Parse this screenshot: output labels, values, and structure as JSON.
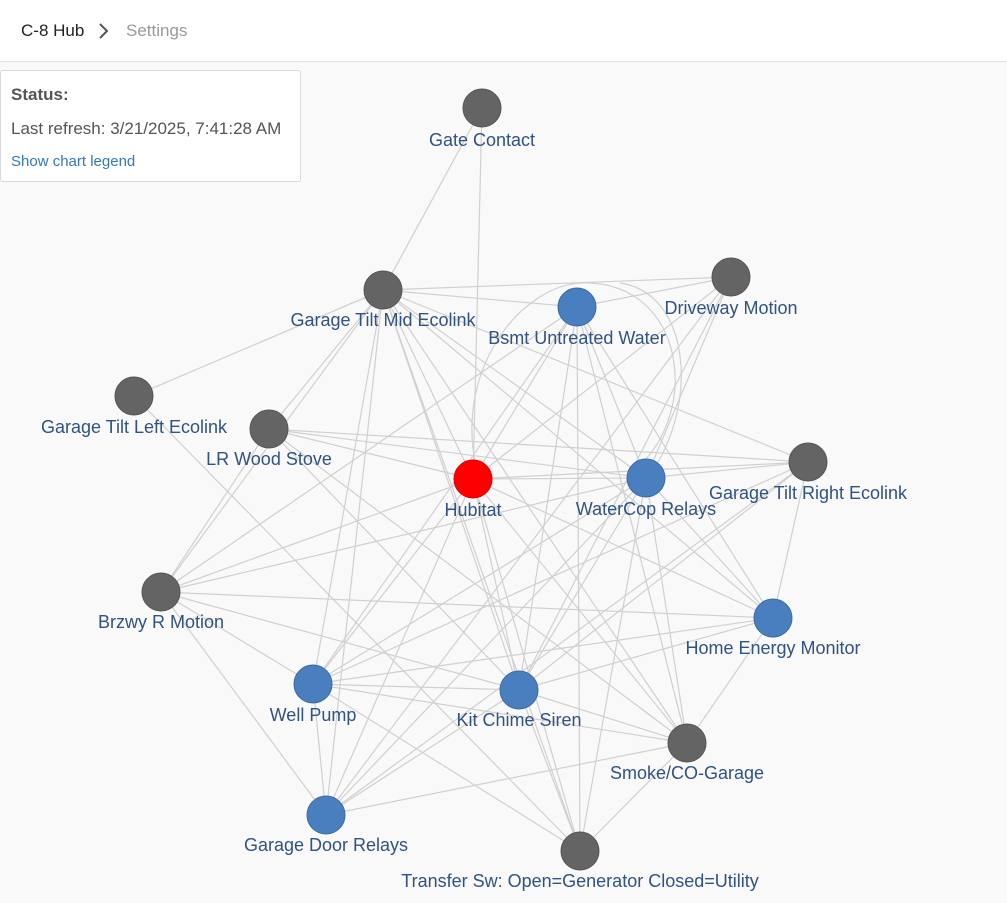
{
  "breadcrumb": {
    "hub": "C-8 Hub",
    "current": "Settings"
  },
  "status": {
    "title": "Status:",
    "last_refresh": "Last refresh: 3/21/2025, 7:41:28 AM",
    "legend_link": "Show chart legend"
  },
  "colors": {
    "hub": "#ff0000",
    "repeater": "#4a7fbf",
    "device": "#646464",
    "edge": "#d0d0d0",
    "label": "#2f5384"
  },
  "nodes": [
    {
      "id": "gate",
      "label": "Gate Contact",
      "kind": "device"
    },
    {
      "id": "gtmid",
      "label": "Garage Tilt Mid Ecolink",
      "kind": "device"
    },
    {
      "id": "bsmt",
      "label": "Bsmt Untreated Water",
      "kind": "repeater"
    },
    {
      "id": "drive",
      "label": "Driveway Motion",
      "kind": "device"
    },
    {
      "id": "gtleft",
      "label": "Garage Tilt Left Ecolink",
      "kind": "device"
    },
    {
      "id": "lrwood",
      "label": "LR Wood Stove",
      "kind": "device"
    },
    {
      "id": "hubitat",
      "label": "Hubitat",
      "kind": "hub"
    },
    {
      "id": "watercop",
      "label": "WaterCop Relays",
      "kind": "repeater"
    },
    {
      "id": "gtright",
      "label": "Garage Tilt Right Ecolink",
      "kind": "device"
    },
    {
      "id": "brzwy",
      "label": "Brzwy R Motion",
      "kind": "device"
    },
    {
      "id": "hem",
      "label": "Home Energy Monitor",
      "kind": "repeater"
    },
    {
      "id": "well",
      "label": "Well Pump",
      "kind": "repeater"
    },
    {
      "id": "chime",
      "label": "Kit Chime Siren",
      "kind": "repeater"
    },
    {
      "id": "smoke",
      "label": "Smoke/CO-Garage",
      "kind": "device"
    },
    {
      "id": "gdr",
      "label": "Garage Door Relays",
      "kind": "repeater"
    },
    {
      "id": "xfer",
      "label": "Transfer Sw: Open=Generator  Closed=Utility",
      "kind": "device"
    }
  ],
  "edges": [
    [
      "gate",
      "gtmid"
    ],
    [
      "gate",
      "hubitat"
    ],
    [
      "gtmid",
      "drive"
    ],
    [
      "gtmid",
      "bsmt"
    ],
    [
      "gtmid",
      "gtleft"
    ],
    [
      "gtmid",
      "lrwood"
    ],
    [
      "gtmid",
      "hubitat"
    ],
    [
      "gtmid",
      "watercop"
    ],
    [
      "gtmid",
      "gtright"
    ],
    [
      "gtmid",
      "brzwy"
    ],
    [
      "gtmid",
      "well"
    ],
    [
      "gtmid",
      "chime"
    ],
    [
      "gtmid",
      "gdr"
    ],
    [
      "gtmid",
      "smoke"
    ],
    [
      "gtmid",
      "xfer"
    ],
    [
      "gtmid",
      "hem"
    ],
    [
      "bsmt",
      "hubitat"
    ],
    [
      "bsmt",
      "drive"
    ],
    [
      "bsmt",
      "watercop"
    ],
    [
      "bsmt",
      "chime"
    ],
    [
      "bsmt",
      "well"
    ],
    [
      "bsmt",
      "smoke"
    ],
    [
      "bsmt",
      "xfer"
    ],
    [
      "bsmt",
      "brzwy"
    ],
    [
      "bsmt",
      "hem"
    ],
    [
      "drive",
      "hubitat"
    ],
    [
      "drive",
      "watercop"
    ],
    [
      "drive",
      "chime"
    ],
    [
      "drive",
      "gdr"
    ],
    [
      "lrwood",
      "hubitat"
    ],
    [
      "lrwood",
      "watercop"
    ],
    [
      "lrwood",
      "gtright"
    ],
    [
      "lrwood",
      "chime"
    ],
    [
      "lrwood",
      "brzwy"
    ],
    [
      "lrwood",
      "smoke"
    ],
    [
      "gtleft",
      "xfer"
    ],
    [
      "hubitat",
      "watercop"
    ],
    [
      "hubitat",
      "gtright"
    ],
    [
      "hubitat",
      "brzwy"
    ],
    [
      "hubitat",
      "chime"
    ],
    [
      "hubitat",
      "well"
    ],
    [
      "hubitat",
      "gdr"
    ],
    [
      "hubitat",
      "hem"
    ],
    [
      "hubitat",
      "xfer"
    ],
    [
      "hubitat",
      "smoke"
    ],
    [
      "watercop",
      "gtright"
    ],
    [
      "watercop",
      "brzwy"
    ],
    [
      "watercop",
      "hem"
    ],
    [
      "watercop",
      "chime"
    ],
    [
      "watercop",
      "well"
    ],
    [
      "watercop",
      "gdr"
    ],
    [
      "watercop",
      "smoke"
    ],
    [
      "watercop",
      "xfer"
    ],
    [
      "gtright",
      "well"
    ],
    [
      "gtright",
      "chime"
    ],
    [
      "gtright",
      "gdr"
    ],
    [
      "gtright",
      "hem"
    ],
    [
      "brzwy",
      "hem"
    ],
    [
      "brzwy",
      "chime"
    ],
    [
      "brzwy",
      "gdr"
    ],
    [
      "brzwy",
      "well"
    ],
    [
      "hem",
      "smoke"
    ],
    [
      "hem",
      "chime"
    ],
    [
      "hem",
      "well"
    ],
    [
      "well",
      "chime"
    ],
    [
      "well",
      "smoke"
    ],
    [
      "well",
      "xfer"
    ],
    [
      "well",
      "gdr"
    ],
    [
      "chime",
      "smoke"
    ],
    [
      "chime",
      "xfer"
    ],
    [
      "chime",
      "gdr"
    ],
    [
      "smoke",
      "gdr"
    ],
    [
      "smoke",
      "xfer"
    ]
  ]
}
